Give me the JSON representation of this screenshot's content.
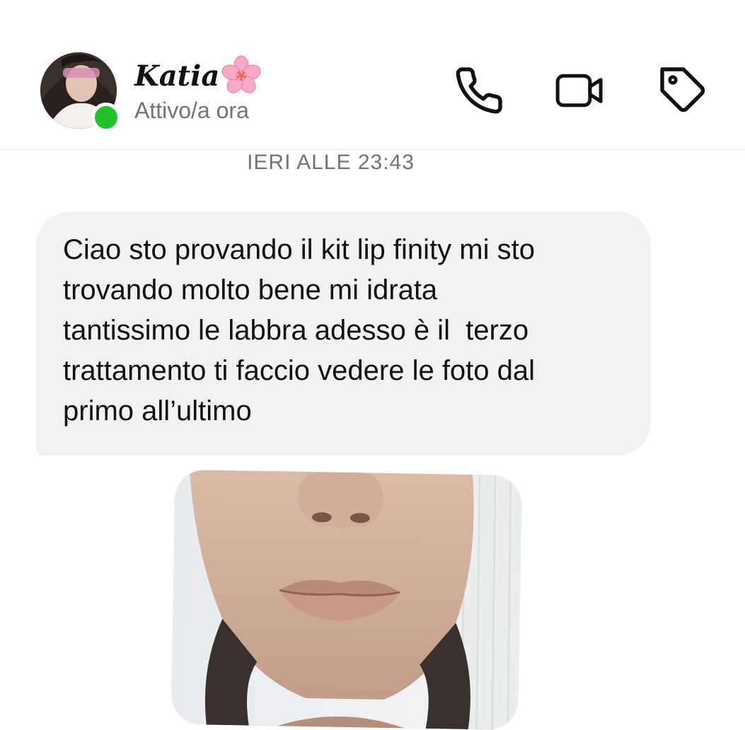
{
  "header": {
    "contact_name": "Katia",
    "status": "Attivo/a ora",
    "avatar_icon": "profile-photo",
    "online_indicator_color": "#22c32a",
    "actions": [
      {
        "icon": "phone-icon"
      },
      {
        "icon": "video-camera-icon"
      },
      {
        "icon": "tag-icon"
      }
    ]
  },
  "conversation": {
    "timestamp": "IERI ALLE 23:43",
    "messages": [
      {
        "type": "text",
        "direction": "incoming",
        "text": "Ciao sto provando il kit lip finity mi sto\ntrovando molto bene mi idrata\ntantissimo le labbra adesso è il  terzo\ntrattamento ti faccio vedere le foto dal\nprimo all’ultimo",
        "bubble_color": "#f2f2f5"
      },
      {
        "type": "photo",
        "direction": "incoming",
        "content": "lips-closeup-photo"
      }
    ]
  }
}
